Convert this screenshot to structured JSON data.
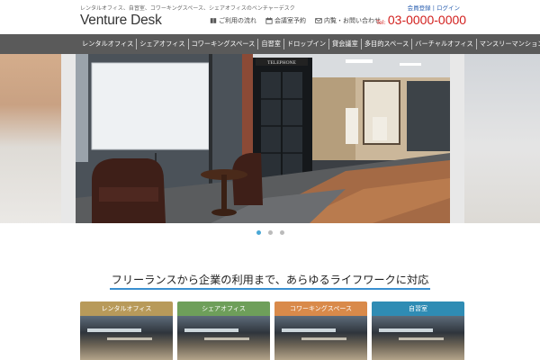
{
  "header": {
    "tagline": "レンタルオフィス、自習室、コワーキングスペース、シェアオフィスのベンチャーデスク",
    "member_register": "会員登録",
    "separator": "|",
    "login": "ログイン",
    "logo": "Venture Desk",
    "nav": [
      {
        "label": "ご利用の流れ",
        "icon": "book-icon"
      },
      {
        "label": "会議室予約",
        "icon": "calendar-icon"
      },
      {
        "label": "内覧・お問い合わせ",
        "icon": "mail-icon"
      }
    ],
    "tel_label": "Tel:",
    "tel_number": "03-0000-0000"
  },
  "main_nav": {
    "items": [
      "レンタルオフィス",
      "シェアオフィス",
      "コワーキングスペース",
      "自習室",
      "ドロップイン",
      "貸会議室",
      "多目的スペース",
      "バーチャルオフィス",
      "マンスリーマンション"
    ]
  },
  "slider": {
    "booth_sign": "TELEPHONE",
    "dot_count": 3,
    "active_index": 0
  },
  "section": {
    "heading": "フリーランスから企業の利用まで、あらゆるライフワークに対応"
  },
  "cards": [
    {
      "label": "レンタルオフィス",
      "color": "#b89a5a"
    },
    {
      "label": "シェアオフィス",
      "color": "#6e9f5a"
    },
    {
      "label": "コワーキングスペース",
      "color": "#d98a4a"
    },
    {
      "label": "自習室",
      "color": "#2f8cb4"
    }
  ],
  "colors": {
    "accent_blue": "#3a8fd0",
    "tel_red": "#d2201e",
    "nav_bg": "#5a5a5a"
  }
}
